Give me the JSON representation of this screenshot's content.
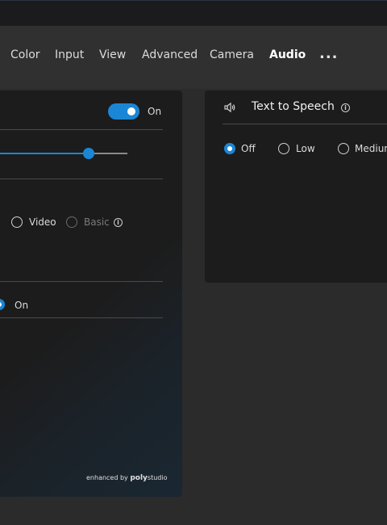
{
  "tabs": [
    {
      "label": "Color"
    },
    {
      "label": "Input"
    },
    {
      "label": "View"
    },
    {
      "label": "Advanced"
    },
    {
      "label": "Camera"
    },
    {
      "label": "Audio",
      "active": true
    }
  ],
  "more_label": "...",
  "left_panel": {
    "toggle_state": "On",
    "slider_level": 0.75,
    "mode_options": [
      {
        "label": "Video",
        "selected": false
      },
      {
        "label": "Basic",
        "selected": false,
        "disabled": true
      }
    ],
    "second_option_label": "On",
    "brand": {
      "prefix": "enhanced by",
      "name": "poly",
      "suffix": "studio"
    }
  },
  "text_to_speech": {
    "title": "Text to Speech",
    "options": [
      {
        "label": "Off",
        "selected": true
      },
      {
        "label": "Low",
        "selected": false
      },
      {
        "label": "Medium",
        "selected": false
      }
    ]
  },
  "colors": {
    "accent": "#1b86d6",
    "panel_bg": "#1c1c1c",
    "window_bg": "#2b2b2b"
  }
}
